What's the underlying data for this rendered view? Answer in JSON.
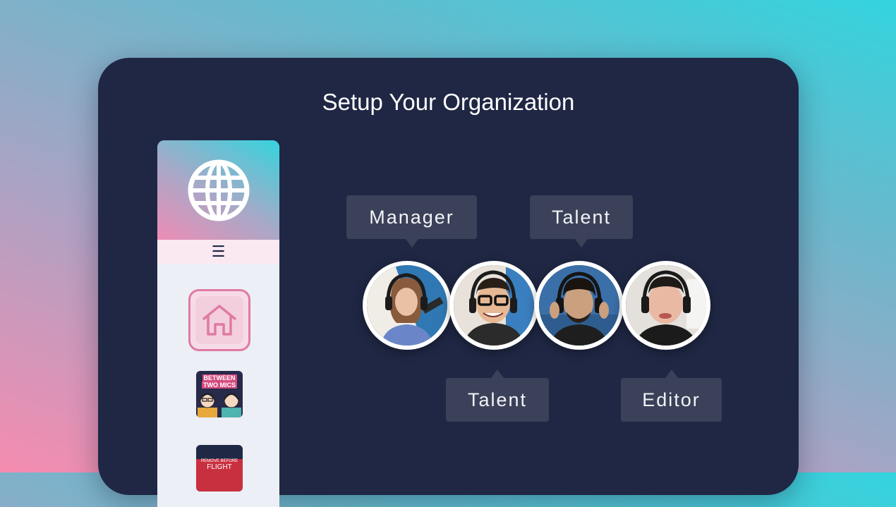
{
  "card": {
    "title": "Setup Your Organization"
  },
  "sidebar": {
    "logo_icon": "globe-icon",
    "menu_icon": "hamburger-icon",
    "menu_glyph": "☰",
    "home_icon": "home-icon",
    "podcasts": [
      {
        "line1": "BETWEEN",
        "line2": "TWO MICS"
      },
      {
        "line1": "REMOVE  BEFORE",
        "line2": "FLIGHT"
      }
    ]
  },
  "roles": {
    "avatar1": "Manager",
    "avatar2": "Talent",
    "avatar3": "Talent",
    "avatar4": "Editor"
  },
  "colors": {
    "card_bg": "#1f2744",
    "tag_bg": "#3a4158",
    "accent_pink": "#e07aa3",
    "accent_teal": "#33d4de"
  }
}
